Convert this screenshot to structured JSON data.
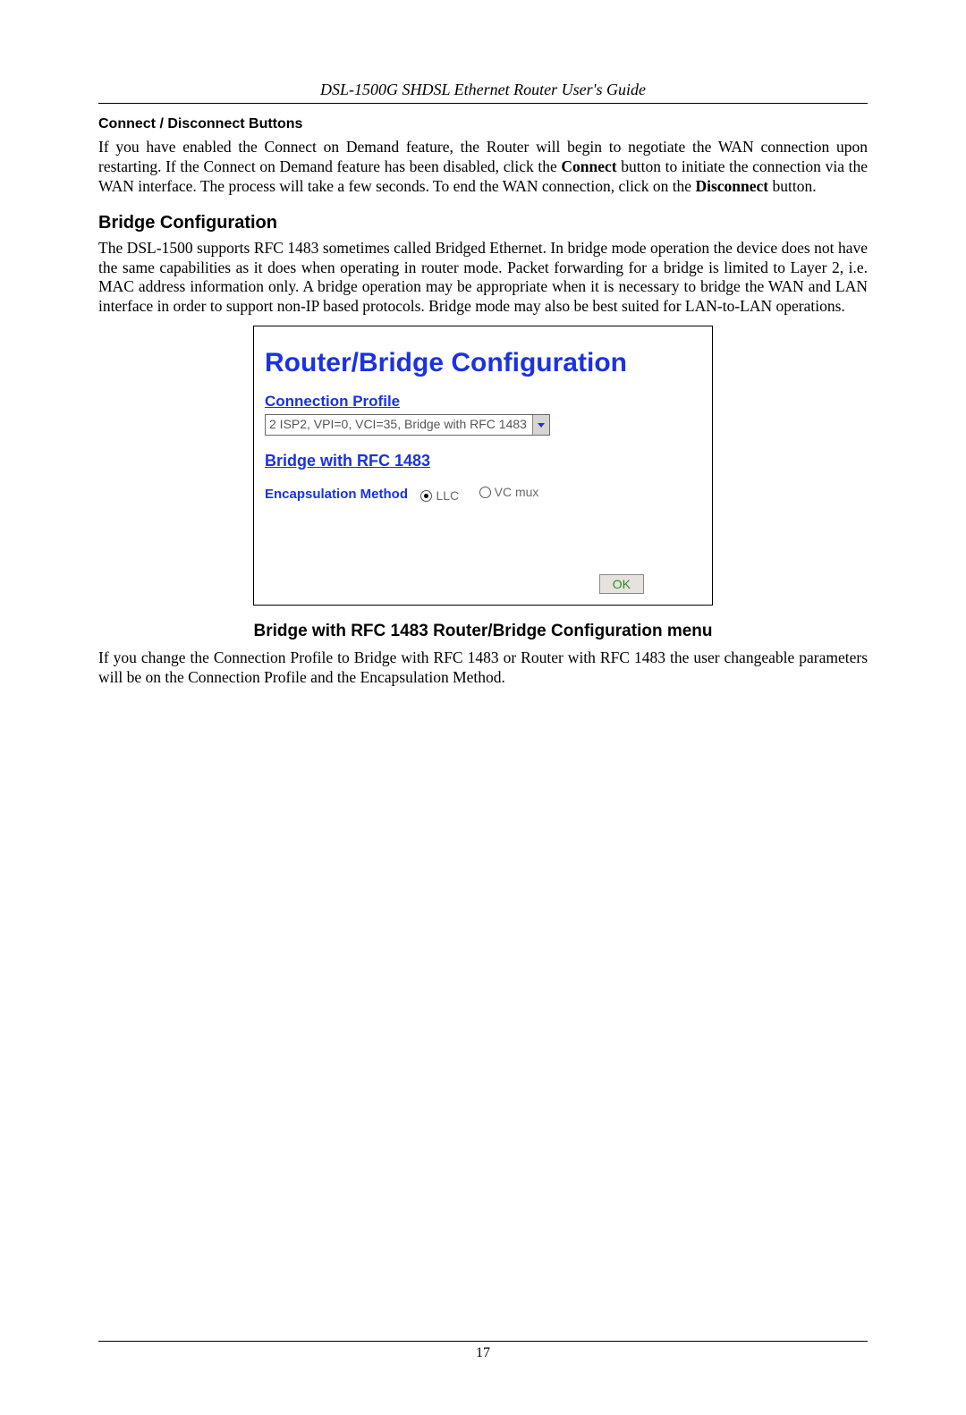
{
  "header": {
    "title": "DSL-1500G SHDSL Ethernet Router User's Guide"
  },
  "sections": {
    "connect_disconnect_title": "Connect / Disconnect Buttons",
    "connect_disconnect_body_a": "If you have enabled the Connect on Demand feature, the Router will begin to negotiate the WAN connection upon restarting. If the Connect on Demand feature has been disabled, click the ",
    "connect_label": "Connect",
    "connect_disconnect_body_b": " button to initiate the connection via the WAN interface. The process will take a few seconds. To end the WAN connection, click on the ",
    "disconnect_label": "Disconnect",
    "connect_disconnect_body_c": " button.",
    "bridge_config_title": "Bridge Configuration",
    "bridge_config_body": "The DSL-1500 supports RFC 1483 sometimes called Bridged Ethernet. In bridge mode operation the device does not have the same capabilities as it does when operating in router mode. Packet forwarding for a bridge is limited to Layer 2, i.e. MAC address information only. A bridge operation may be appropriate when it is necessary to bridge the WAN and LAN interface in order to support non-IP based protocols. Bridge mode may also be best suited for LAN-to-LAN operations.",
    "fig_caption": "Bridge with RFC 1483 Router/Bridge Configuration menu",
    "after_fig_body": "If you change the Connection Profile to Bridge with RFC 1483 or Router with RFC 1483 the user changeable parameters will be on the Connection Profile and the Encapsulation Method."
  },
  "shot": {
    "title": "Router/Bridge Configuration",
    "connection_profile_label": "Connection Profile",
    "dropdown_value": "2 ISP2, VPI=0, VCI=35, Bridge with RFC 1483",
    "subsection": "Bridge with RFC 1483",
    "encaps_label": "Encapsulation Method",
    "radio_llc": "LLC",
    "radio_vcmux": "VC mux",
    "ok": "OK"
  },
  "footer": {
    "page": "17"
  }
}
